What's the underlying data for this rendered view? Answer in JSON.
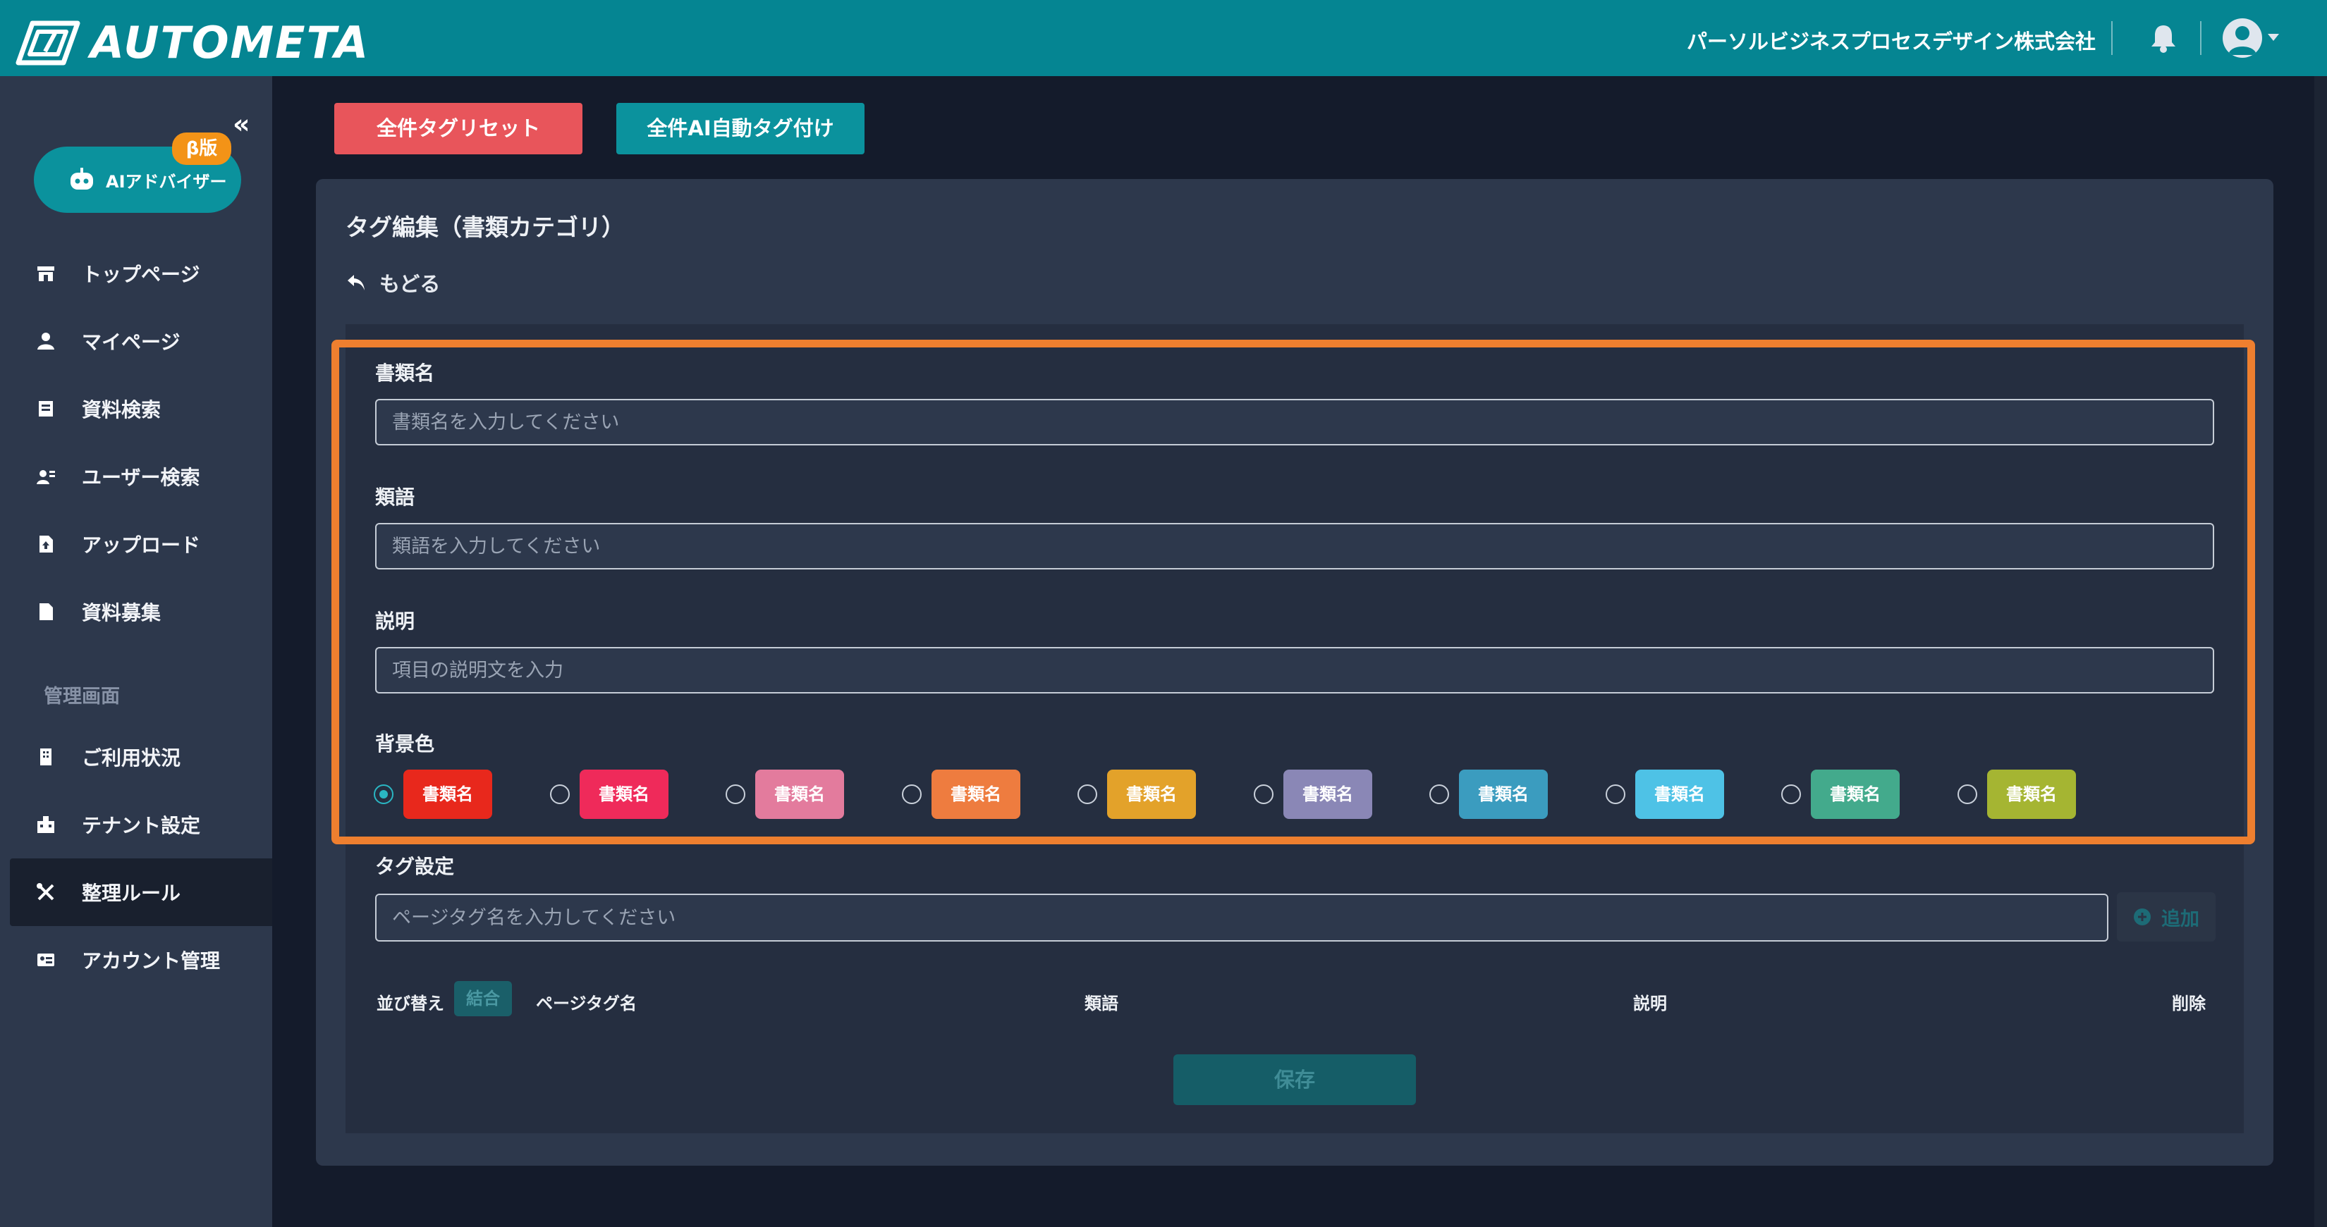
{
  "header": {
    "brand": "AUTOMETA",
    "company": "パーソルビジネスプロセスデザイン株式会社",
    "icons": [
      "logo-icon",
      "bell-icon",
      "user-avatar-icon",
      "caret-down-icon"
    ]
  },
  "sidebar": {
    "collapse": "«",
    "ai_advisor": {
      "label": "AIアドバイザー",
      "badge": "β版"
    },
    "items": [
      {
        "label": "トップページ",
        "icon": "store-icon"
      },
      {
        "label": "マイページ",
        "icon": "person-icon"
      },
      {
        "label": "資料検索",
        "icon": "document-search-icon"
      },
      {
        "label": "ユーザー検索",
        "icon": "user-search-icon"
      },
      {
        "label": "アップロード",
        "icon": "upload-file-icon"
      },
      {
        "label": "資料募集",
        "icon": "file-icon"
      }
    ],
    "admin_section": "管理画面",
    "admin_items": [
      {
        "label": "ご利用状況",
        "icon": "building-icon"
      },
      {
        "label": "テナント設定",
        "icon": "tenant-icon"
      },
      {
        "label": "整理ルール",
        "icon": "tools-icon",
        "active": true
      },
      {
        "label": "アカウント管理",
        "icon": "id-card-icon"
      }
    ]
  },
  "toolbar": {
    "reset_all": "全件タグリセット",
    "ai_tag_all": "全件AI自動タグ付け"
  },
  "editor": {
    "title": "タグ編集（書類カテゴリ）",
    "back": "もどる",
    "doc_name": {
      "label": "書類名",
      "placeholder": "書類名を入力してください"
    },
    "synonym": {
      "label": "類語",
      "placeholder": "類語を入力してください"
    },
    "description": {
      "label": "説明",
      "placeholder": "項目の説明文を入力"
    },
    "bg_color": {
      "label": "背景色",
      "swatch_text": "書類名",
      "selected_index": 0,
      "colors": [
        "#e8281c",
        "#ef2a5a",
        "#e37b9d",
        "#ee7c3f",
        "#e3a22a",
        "#8a87b6",
        "#3b9cbf",
        "#4ec2e6",
        "#43aa8c",
        "#a5b532"
      ]
    },
    "tag_settings": {
      "label": "タグ設定",
      "placeholder": "ページタグ名を入力してください",
      "add": "追加"
    },
    "table_headers": {
      "sort": "並び替え",
      "merge": "結合",
      "page_tag_name": "ページタグ名",
      "synonym": "類語",
      "description": "説明",
      "delete": "削除"
    },
    "save": "保存"
  },
  "colors": {
    "header": "#058592",
    "sidebar": "#2d384c",
    "background": "#141b2b",
    "highlight": "#ee7f2f",
    "danger": "#e8555b",
    "primary": "#0b929d"
  }
}
